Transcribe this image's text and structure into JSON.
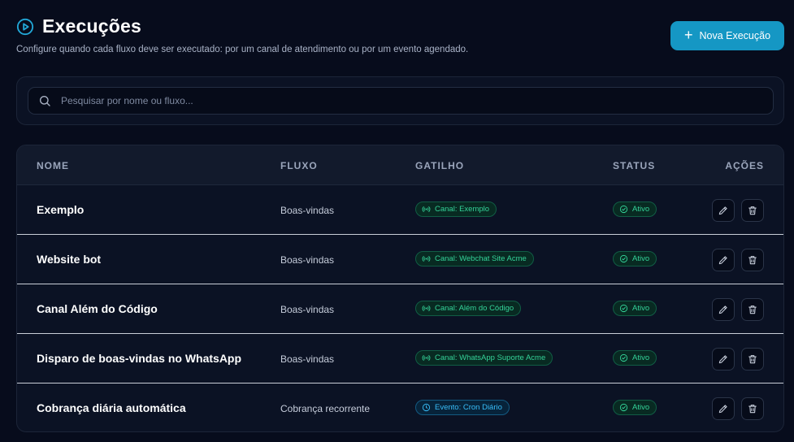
{
  "header": {
    "title": "Execuções",
    "subtitle": "Configure quando cada fluxo deve ser executado: por um canal de atendimento ou por um evento agendado.",
    "new_button_label": "Nova Execução"
  },
  "search": {
    "placeholder": "Pesquisar por nome ou fluxo..."
  },
  "table": {
    "columns": [
      "NOME",
      "FLUXO",
      "GATILHO",
      "STATUS",
      "AÇÕES"
    ],
    "rows": [
      {
        "name": "Exemplo",
        "flow": "Boas-vindas",
        "trigger": "Canal: Exemplo",
        "trigger_type": "channel",
        "status": "Ativo"
      },
      {
        "name": "Website bot",
        "flow": "Boas-vindas",
        "trigger": "Canal: Webchat Site Acme",
        "trigger_type": "channel",
        "status": "Ativo"
      },
      {
        "name": "Canal Além do Código",
        "flow": "Boas-vindas",
        "trigger": "Canal: Além do Código",
        "trigger_type": "channel",
        "status": "Ativo"
      },
      {
        "name": "Disparo de boas-vindas no WhatsApp",
        "flow": "Boas-vindas",
        "trigger": "Canal: WhatsApp Suporte Acme",
        "trigger_type": "channel",
        "status": "Ativo"
      },
      {
        "name": "Cobrança diária automática",
        "flow": "Cobrança recorrente",
        "trigger": "Evento: Cron Diário",
        "trigger_type": "event",
        "status": "Ativo"
      }
    ]
  },
  "colors": {
    "background": "#070c1c",
    "accent": "#1597c4",
    "success": "#34d399",
    "event": "#38bdf8"
  },
  "icons": {
    "title": "play-circle-icon",
    "new": "plus-icon",
    "search": "search-icon",
    "channel": "broadcast-icon",
    "event": "clock-icon",
    "status": "check-circle-icon",
    "edit": "pencil-icon",
    "delete": "trash-icon"
  }
}
